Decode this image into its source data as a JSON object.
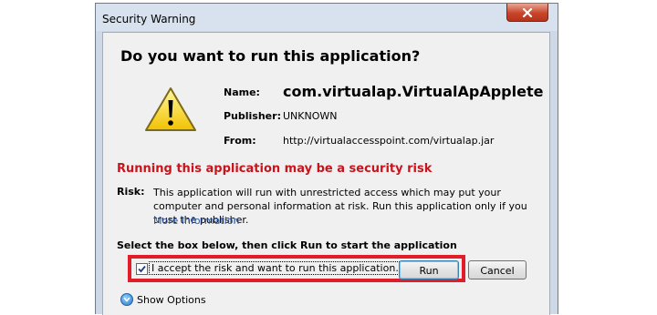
{
  "window": {
    "title": "Security Warning",
    "close_icon": "close-icon"
  },
  "dialog": {
    "heading": "Do you want to run this application?",
    "icon": "warning-icon",
    "name_label": "Name:",
    "name_value": "com.virtualap.VirtualApApplete",
    "publisher_label": "Publisher:",
    "publisher_value": "UNKNOWN",
    "from_label": "From:",
    "from_value": "http://virtualaccesspoint.com/virtualap.jar",
    "risk_heading": "Running this application may be a security risk",
    "risk_label": "Risk:",
    "risk_text": "This application will run with unrestricted access which may put your computer and personal information at risk. Run this application only if you trust the publisher.",
    "more_info": "More Information",
    "instruction": "Select the box below, then click Run to start the application",
    "checkbox_label": "I accept the risk and want to run this application.",
    "checkbox_checked": true,
    "run_button": "Run",
    "cancel_button": "Cancel",
    "show_options": "Show Options",
    "show_options_icon": "chevron-down-circle-icon"
  },
  "colors": {
    "risk_red": "#c8141c",
    "highlight_red": "#e11d2a",
    "link_blue": "#2e5aa8"
  }
}
